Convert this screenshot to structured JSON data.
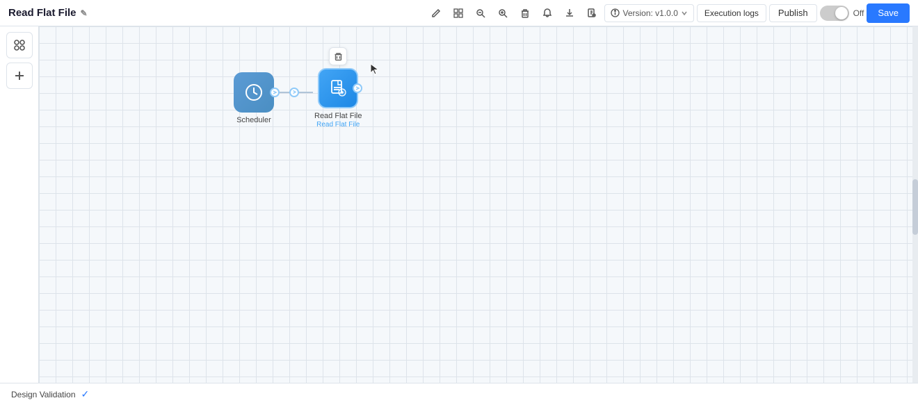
{
  "header": {
    "title": "Read Flat File",
    "edit_icon": "✎",
    "tools": [
      {
        "name": "pencil-tool",
        "icon": "✏",
        "label": "pencil"
      },
      {
        "name": "move-tool",
        "icon": "⊞",
        "label": "move"
      },
      {
        "name": "zoom-out-tool",
        "icon": "−",
        "label": "zoom-out"
      },
      {
        "name": "zoom-in-tool",
        "icon": "+",
        "label": "zoom-in"
      },
      {
        "name": "delete-tool",
        "icon": "🗑",
        "label": "delete"
      },
      {
        "name": "bell-tool",
        "icon": "🔔",
        "label": "notifications"
      },
      {
        "name": "download-tool",
        "icon": "⬇",
        "label": "download"
      },
      {
        "name": "export-tool",
        "icon": "📄",
        "label": "export"
      }
    ],
    "version": "Version: v1.0.0",
    "exec_logs_label": "Execution logs",
    "publish_label": "Publish",
    "toggle_label": "Off",
    "save_label": "Save"
  },
  "sidebar": {
    "tools_label": "tools",
    "add_label": "add"
  },
  "canvas": {
    "nodes": [
      {
        "id": "scheduler",
        "label": "Scheduler",
        "sublabel": "",
        "type": "scheduler"
      },
      {
        "id": "read-flat-file",
        "label": "Read Flat File",
        "sublabel": "Read Flat File",
        "type": "read-flat"
      }
    ]
  },
  "bottom_bar": {
    "design_validation_label": "Design Validation"
  }
}
